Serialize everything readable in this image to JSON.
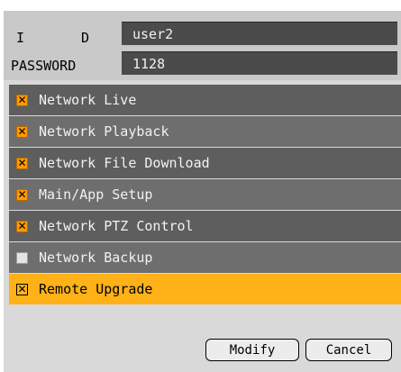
{
  "form": {
    "id_label": "I D",
    "id_value": "user2",
    "password_label": "PASSWORD",
    "password_value": "1128"
  },
  "permissions": [
    {
      "label": "Network Live",
      "checked": true
    },
    {
      "label": "Network Playback",
      "checked": true
    },
    {
      "label": "Network File Download",
      "checked": true
    },
    {
      "label": "Main/App Setup",
      "checked": true
    },
    {
      "label": "Network PTZ Control",
      "checked": true
    },
    {
      "label": "Network Backup",
      "checked": false
    },
    {
      "label": "Remote Upgrade",
      "checked": true
    }
  ],
  "buttons": {
    "modify": "Modify",
    "cancel": "Cancel"
  },
  "colors": {
    "selected_row": "#ffb217",
    "checkbox_checked": "#ff9a00",
    "row_dark": "#5e5e5e",
    "row_light": "#6e6e6e",
    "field_bg": "#4b4b4b"
  }
}
